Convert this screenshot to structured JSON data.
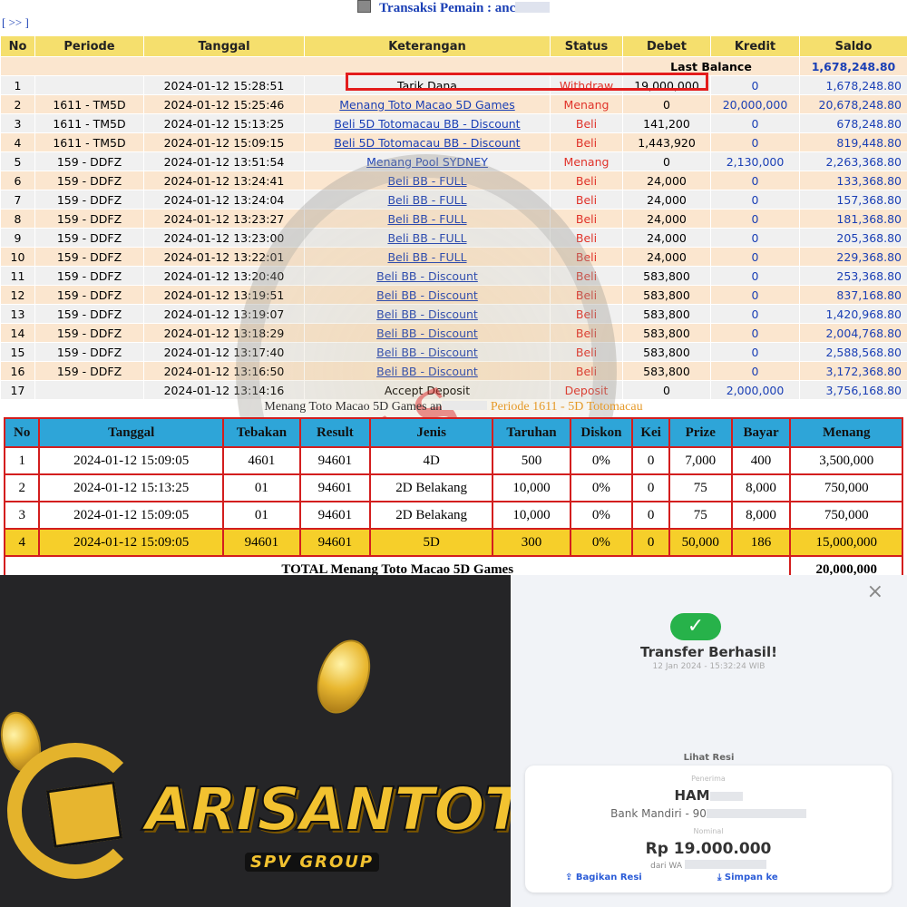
{
  "header": {
    "nav_link": "[ >> ]",
    "title_prefix": "Transaksi   Pemain : anc"
  },
  "tx_table": {
    "columns": [
      "No",
      "Periode",
      "Tanggal",
      "Keterangan",
      "Status",
      "Debet",
      "Kredit",
      "Saldo"
    ],
    "last_balance_label": "Last Balance",
    "last_balance_value": "1,678,248.80",
    "rows": [
      {
        "no": "1",
        "periode": "",
        "tanggal": "2024-01-12 15:28:51",
        "ket": "Tarik Dana",
        "status": "Withdraw",
        "debet": "19,000,000",
        "kredit": "0",
        "saldo": "1,678,248.80"
      },
      {
        "no": "2",
        "periode": "1611 - TM5D",
        "tanggal": "2024-01-12 15:25:46",
        "ket": "Menang Toto Macao 5D Games",
        "status": "Menang",
        "debet": "0",
        "kredit": "20,000,000",
        "saldo": "20,678,248.80"
      },
      {
        "no": "3",
        "periode": "1611 - TM5D",
        "tanggal": "2024-01-12 15:13:25",
        "ket": "Beli 5D Totomacau BB - Discount",
        "status": "Beli",
        "debet": "141,200",
        "kredit": "0",
        "saldo": "678,248.80"
      },
      {
        "no": "4",
        "periode": "1611 - TM5D",
        "tanggal": "2024-01-12 15:09:15",
        "ket": "Beli 5D Totomacau BB - Discount",
        "status": "Beli",
        "debet": "1,443,920",
        "kredit": "0",
        "saldo": "819,448.80"
      },
      {
        "no": "5",
        "periode": "159 - DDFZ",
        "tanggal": "2024-01-12 13:51:54",
        "ket": "Menang Pool SYDNEY",
        "status": "Menang",
        "debet": "0",
        "kredit": "2,130,000",
        "saldo": "2,263,368.80"
      },
      {
        "no": "6",
        "periode": "159 - DDFZ",
        "tanggal": "2024-01-12 13:24:41",
        "ket": "Beli BB - FULL",
        "status": "Beli",
        "debet": "24,000",
        "kredit": "0",
        "saldo": "133,368.80"
      },
      {
        "no": "7",
        "periode": "159 - DDFZ",
        "tanggal": "2024-01-12 13:24:04",
        "ket": "Beli BB - FULL",
        "status": "Beli",
        "debet": "24,000",
        "kredit": "0",
        "saldo": "157,368.80"
      },
      {
        "no": "8",
        "periode": "159 - DDFZ",
        "tanggal": "2024-01-12 13:23:27",
        "ket": "Beli BB - FULL",
        "status": "Beli",
        "debet": "24,000",
        "kredit": "0",
        "saldo": "181,368.80"
      },
      {
        "no": "9",
        "periode": "159 - DDFZ",
        "tanggal": "2024-01-12 13:23:00",
        "ket": "Beli BB - FULL",
        "status": "Beli",
        "debet": "24,000",
        "kredit": "0",
        "saldo": "205,368.80"
      },
      {
        "no": "10",
        "periode": "159 - DDFZ",
        "tanggal": "2024-01-12 13:22:01",
        "ket": "Beli BB - FULL",
        "status": "Beli",
        "debet": "24,000",
        "kredit": "0",
        "saldo": "229,368.80"
      },
      {
        "no": "11",
        "periode": "159 - DDFZ",
        "tanggal": "2024-01-12 13:20:40",
        "ket": "Beli BB - Discount",
        "status": "Beli",
        "debet": "583,800",
        "kredit": "0",
        "saldo": "253,368.80"
      },
      {
        "no": "12",
        "periode": "159 - DDFZ",
        "tanggal": "2024-01-12 13:19:51",
        "ket": "Beli BB - Discount",
        "status": "Beli",
        "debet": "583,800",
        "kredit": "0",
        "saldo": "837,168.80"
      },
      {
        "no": "13",
        "periode": "159 - DDFZ",
        "tanggal": "2024-01-12 13:19:07",
        "ket": "Beli BB - Discount",
        "status": "Beli",
        "debet": "583,800",
        "kredit": "0",
        "saldo": "1,420,968.80"
      },
      {
        "no": "14",
        "periode": "159 - DDFZ",
        "tanggal": "2024-01-12 13:18:29",
        "ket": "Beli BB - Discount",
        "status": "Beli",
        "debet": "583,800",
        "kredit": "0",
        "saldo": "2,004,768.80"
      },
      {
        "no": "15",
        "periode": "159 - DDFZ",
        "tanggal": "2024-01-12 13:17:40",
        "ket": "Beli BB - Discount",
        "status": "Beli",
        "debet": "583,800",
        "kredit": "0",
        "saldo": "2,588,568.80"
      },
      {
        "no": "16",
        "periode": "159 - DDFZ",
        "tanggal": "2024-01-12 13:16:50",
        "ket": "Beli BB - Discount",
        "status": "Beli",
        "debet": "583,800",
        "kredit": "0",
        "saldo": "3,172,368.80"
      },
      {
        "no": "17",
        "periode": "",
        "tanggal": "2024-01-12 13:14:16",
        "ket": "Accept Deposit",
        "status": "Deposit",
        "debet": "0",
        "kredit": "2,000,000",
        "saldo": "3,756,168.80"
      }
    ]
  },
  "menang_table": {
    "title_prefix": "Menang Toto Macao 5D Games an",
    "title_periode": "Periode 1611 - 5D Totomacau",
    "columns": [
      "No",
      "Tanggal",
      "Tebakan",
      "Result",
      "Jenis",
      "Taruhan",
      "Diskon",
      "Kei",
      "Prize",
      "Bayar",
      "Menang"
    ],
    "rows": [
      {
        "no": "1",
        "tanggal": "2024-01-12 15:09:05",
        "tebakan": "4601",
        "result": "94601",
        "jenis": "4D",
        "taruhan": "500",
        "diskon": "0%",
        "kei": "0",
        "prize": "7,000",
        "bayar": "400",
        "menang": "3,500,000"
      },
      {
        "no": "2",
        "tanggal": "2024-01-12 15:13:25",
        "tebakan": "01",
        "result": "94601",
        "jenis": "2D Belakang",
        "taruhan": "10,000",
        "diskon": "0%",
        "kei": "0",
        "prize": "75",
        "bayar": "8,000",
        "menang": "750,000"
      },
      {
        "no": "3",
        "tanggal": "2024-01-12 15:09:05",
        "tebakan": "01",
        "result": "94601",
        "jenis": "2D Belakang",
        "taruhan": "10,000",
        "diskon": "0%",
        "kei": "0",
        "prize": "75",
        "bayar": "8,000",
        "menang": "750,000"
      },
      {
        "no": "4",
        "tanggal": "2024-01-12 15:09:05",
        "tebakan": "94601",
        "result": "94601",
        "jenis": "5D",
        "taruhan": "300",
        "diskon": "0%",
        "kei": "0",
        "prize": "50,000",
        "bayar": "186",
        "menang": "15,000,000"
      }
    ],
    "total_label": "TOTAL  Menang Toto Macao 5D Games",
    "total_value": "20,000,000"
  },
  "brand": {
    "logo_text": "ARISANTOTO",
    "sub_text": "SPV GROUP",
    "icon": "slot-reel-icon"
  },
  "transfer": {
    "close": "×",
    "check_icon": "✓",
    "title": "Transfer Berhasil!",
    "date": "12 Jan 2024 - 15:32:24 WIB",
    "lihat_resi": "Lihat Resi",
    "penerima_label": "Penerima",
    "recipient_name": "HAM",
    "bank": "Bank Mandiri - 90",
    "nominal_label": "Nominal",
    "amount": "Rp 19.000.000",
    "dari": "dari WA",
    "bagikan": "Bagikan Resi",
    "simpan": "Simpan ke"
  },
  "watermark": {
    "stamp_text": "LUNAS"
  },
  "colors": {
    "header_yellow": "#f5df6d",
    "link_blue": "#1a3fb5",
    "status_red": "#e0332a",
    "table_border_red": "#d31e1e",
    "header_cyan": "#2ea5d8",
    "win_row_gold": "#f6cf2a",
    "success_green": "#27b24a",
    "brand_gold": "#f2c230"
  }
}
